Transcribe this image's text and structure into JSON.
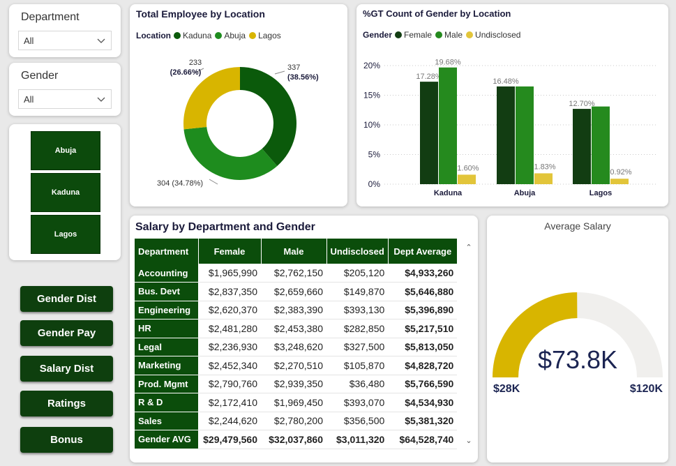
{
  "filters": {
    "department": {
      "label": "Department",
      "value": "All"
    },
    "gender": {
      "label": "Gender",
      "value": "All"
    }
  },
  "location_buttons": [
    "Abuja",
    "Kaduna",
    "Lagos"
  ],
  "nav_buttons": [
    "Gender Dist",
    "Gender Pay",
    "Salary Dist",
    "Ratings",
    "Bonus"
  ],
  "donut": {
    "title": "Total Employee by Location",
    "legend_title": "Location",
    "colors": {
      "Kaduna": "#0b5a0b",
      "Abuja": "#1e8c1e",
      "Lagos": "#d8b500"
    },
    "chart_data": {
      "type": "pie",
      "categories": [
        "Kaduna",
        "Abuja",
        "Lagos"
      ],
      "values": [
        337,
        304,
        233
      ],
      "percents": [
        "38.56%",
        "34.78%",
        "26.66%"
      ],
      "labels": {
        "Kaduna": "337",
        "Kaduna_pct": "(38.56%)",
        "Abuja": "304 (34.78%)",
        "Lagos": "233",
        "Lagos_pct": "(26.66%)"
      }
    }
  },
  "bar": {
    "title": "%GT Count of Gender by Location",
    "legend_title": "Gender",
    "colors": {
      "Female": "#123d12",
      "Male": "#258a1e",
      "Undisclosed": "#e2c53a"
    },
    "chart_data": {
      "type": "bar",
      "categories": [
        "Kaduna",
        "Abuja",
        "Lagos"
      ],
      "series": [
        {
          "name": "Female",
          "values": [
            17.28,
            16.48,
            12.7
          ],
          "labels": [
            "17.28%",
            "16.48%",
            "12.70%"
          ]
        },
        {
          "name": "Male",
          "values": [
            19.68,
            16.48,
            13.1
          ],
          "labels": [
            "19.68%",
            "",
            ""
          ]
        },
        {
          "name": "Undisclosed",
          "values": [
            1.6,
            1.83,
            0.92
          ],
          "labels": [
            "1.60%",
            "1.83%",
            "0.92%"
          ]
        }
      ],
      "yticks": [
        "0%",
        "5%",
        "10%",
        "15%",
        "20%"
      ],
      "ylim": [
        0,
        20
      ]
    }
  },
  "table": {
    "title": "Salary by Department and Gender",
    "headers": [
      "Department",
      "Female",
      "Male",
      "Undisclosed",
      "Dept Average"
    ],
    "rows": [
      [
        "Accounting",
        "$1,965,990",
        "$2,762,150",
        "$205,120",
        "$4,933,260"
      ],
      [
        "Bus. Devt",
        "$2,837,350",
        "$2,659,660",
        "$149,870",
        "$5,646,880"
      ],
      [
        "Engineering",
        "$2,620,370",
        "$2,383,390",
        "$393,130",
        "$5,396,890"
      ],
      [
        "HR",
        "$2,481,280",
        "$2,453,380",
        "$282,850",
        "$5,217,510"
      ],
      [
        "Legal",
        "$2,236,930",
        "$3,248,620",
        "$327,500",
        "$5,813,050"
      ],
      [
        "Marketing",
        "$2,452,340",
        "$2,270,510",
        "$105,870",
        "$4,828,720"
      ],
      [
        "Prod. Mgmt",
        "$2,790,760",
        "$2,939,350",
        "$36,480",
        "$5,766,590"
      ],
      [
        "R & D",
        "$2,172,410",
        "$1,969,450",
        "$393,070",
        "$4,534,930"
      ],
      [
        "Sales",
        "$2,244,620",
        "$2,780,200",
        "$356,500",
        "$5,381,320"
      ]
    ],
    "total": [
      "Gender AVG",
      "$29,479,560",
      "$32,037,860",
      "$3,011,320",
      "$64,528,740"
    ]
  },
  "gauge": {
    "title": "Average Salary",
    "value_label": "$73.8K",
    "min_label": "$28K",
    "max_label": "$120K",
    "value": 73.8,
    "min": 28,
    "max": 120,
    "fill_color": "#d8b500",
    "track_color": "#f0efed",
    "value_color": "#1b2452"
  }
}
